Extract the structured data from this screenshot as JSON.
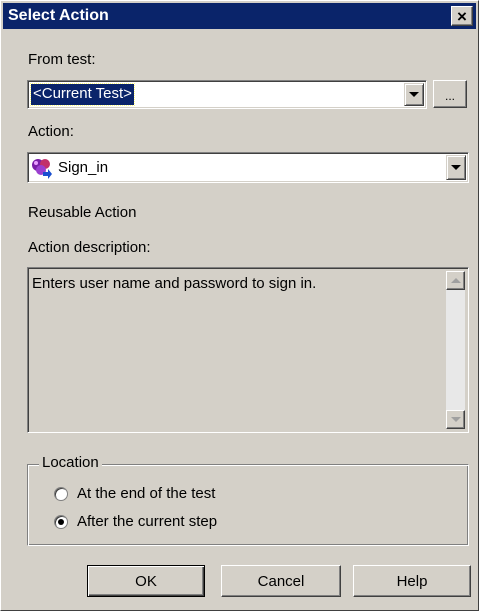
{
  "dialog": {
    "title": "Select Action",
    "close_glyph": "×"
  },
  "from_test": {
    "label": "From test:",
    "value": "<Current Test>",
    "browse_label": "..."
  },
  "action": {
    "label": "Action:",
    "value": "Sign_in",
    "icon": "action-icon"
  },
  "reusable_label": "Reusable Action",
  "description": {
    "label": "Action description:",
    "text": "Enters user name and password to sign in."
  },
  "location": {
    "legend": "Location",
    "options": [
      {
        "label": "At the end of the test",
        "checked": false
      },
      {
        "label": "After the current step",
        "checked": true
      }
    ]
  },
  "buttons": {
    "ok": "OK",
    "cancel": "Cancel",
    "help": "Help"
  },
  "colors": {
    "titlebar": "#0a246a",
    "face": "#d4d0c8",
    "selection": "#0a246a"
  }
}
